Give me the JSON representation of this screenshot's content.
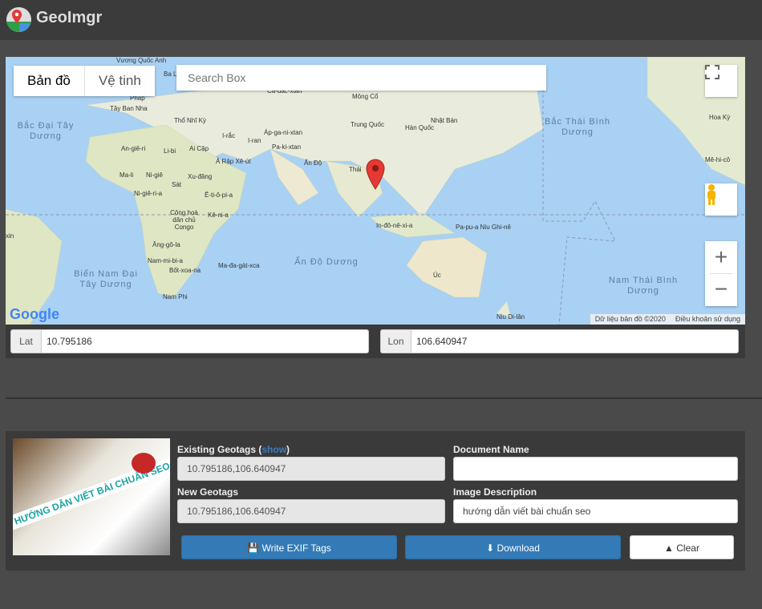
{
  "app": {
    "title": "GeoImgr",
    "logo_icon": "map-pin-logo"
  },
  "map": {
    "type_buttons": [
      "Bản đồ",
      "Vệ tinh"
    ],
    "active_type": "Bản đồ",
    "search_placeholder": "Search Box",
    "labels": [
      "Vương Quốc Anh",
      "Ba Lan",
      "Pháp",
      "Ca-dắc-xtan",
      "Mông Cổ",
      "Tây Ban Nha",
      "Thổ Nhĩ Kỳ",
      "Nhật Bản",
      "Trung Quốc",
      "Hàn Quốc",
      "I-rắc",
      "I-ran",
      "Áp-ga-ni-xtan",
      "Pa-ki-xtan",
      "An-giê-ri",
      "Li-bi",
      "Ai Cập",
      "Ả Rập Xê-út",
      "Ấn Độ",
      "Thái",
      "Ma-li",
      "Ni-giê",
      "Xu-đăng",
      "Ni-giê-ri-a",
      "Sát",
      "Ê-ti-ô-pi-a",
      "Công hoà dân chủ Congo",
      "Kê-ni-a",
      "In-đô-nê-xi-a",
      "Pa-pu-a Niu Ghi-nê",
      "Ăng-gô-la",
      "Nam-mi-bi-a",
      "Bốt-xoa-na",
      "Ma-đa-gát-xca",
      "Úc",
      "Nam Phi",
      "Niu Di-lân",
      "Hoa Kỳ",
      "Mê-hi-cô",
      "xin"
    ],
    "oceans": [
      "Bắc Đại Tây Dương",
      "Bắc Thái Bình Dương",
      "Ấn Độ Dương",
      "Biển Nam Đại Tây Dương",
      "Nam Thái Bình Dương"
    ],
    "attribution": "Dữ liệu bản đồ ©2020",
    "terms": "Điều khoản sử dụng",
    "google_logo": "Google",
    "marker": {
      "lat": 10.795186,
      "lon": 106.640947,
      "color": "#d93025"
    }
  },
  "coords": {
    "lat_label": "Lat",
    "lat_value": "10.795186",
    "lon_label": "Lon",
    "lon_value": "106.640947"
  },
  "form": {
    "existing_label": "Existing Geotags (",
    "show_link": "show",
    "existing_close": ")",
    "existing_value": "10.795186,106.640947",
    "new_label": "New Geotags",
    "new_value": "10.795186,106.640947",
    "docname_label": "Document Name",
    "docname_value": "",
    "desc_label": "Image Description",
    "desc_value": "hướng dẫn viết bài chuẩn seo",
    "thumb_caption": "HƯỚNG DẪN VIẾT BÀI CHUẨN SEO",
    "write_btn": "Write EXIF Tags",
    "download_btn": "Download",
    "clear_btn": "Clear"
  },
  "colors": {
    "primary": "#337ab7",
    "header": "#3b3b3b",
    "ocean": "#a9d1f4",
    "land": "#e8ead9"
  }
}
